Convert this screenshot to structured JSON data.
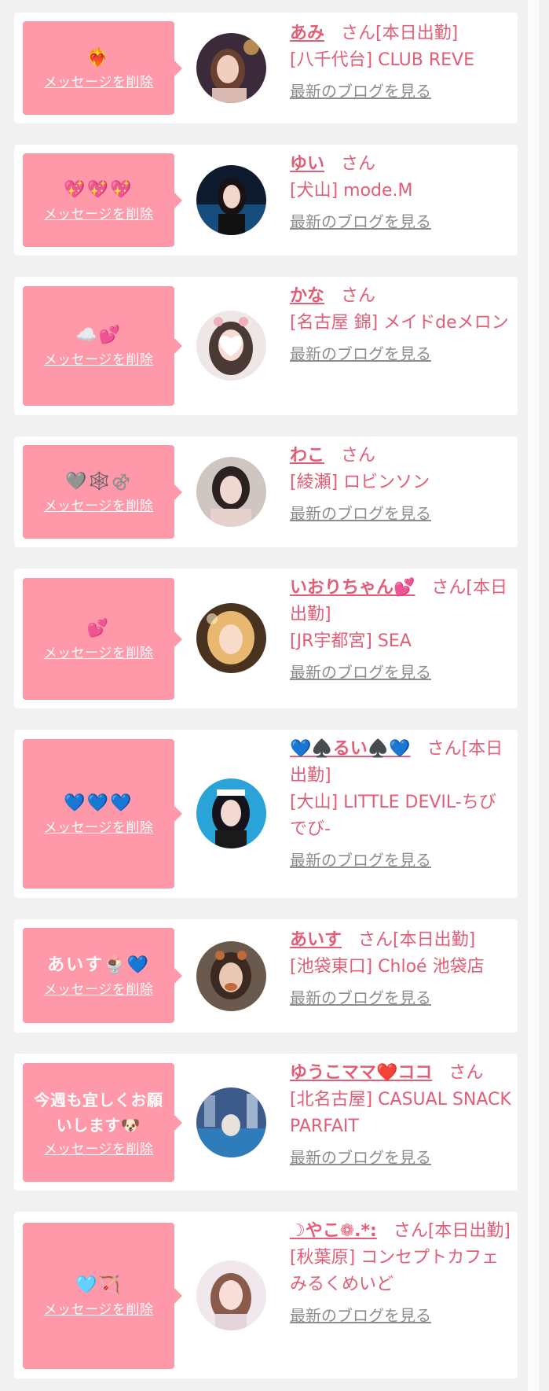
{
  "colors": {
    "bubble": "#ff98a8",
    "accent": "#e25d75",
    "blog_link": "#8d8d8d",
    "page_bg": "#f1f1f1",
    "card_bg": "#ffffff"
  },
  "delete_label": "メッセージを削除",
  "blog_label": "最新のブログを見る",
  "san_label": "さん",
  "on_duty_label": "[本日出勤]",
  "items": [
    {
      "message": "❤‍🔥",
      "name": "あみ",
      "on_duty": true,
      "shop": "[八千代台] CLUB REVE",
      "avatar_icon": "avatar-photo"
    },
    {
      "message": "💖💖💖",
      "name": "ゆい",
      "on_duty": false,
      "shop": "[犬山] mode.M",
      "avatar_icon": "avatar-photo"
    },
    {
      "message": "☁️💕",
      "name": "かな",
      "on_duty": false,
      "shop": "[名古屋 錦] メイドdeメロン",
      "avatar_icon": "avatar-photo"
    },
    {
      "message": "🩶🕸️⚣",
      "name": "わこ",
      "on_duty": false,
      "shop": "[綾瀬] ロビンソン",
      "avatar_icon": "avatar-photo"
    },
    {
      "message": "💕",
      "name": "いおりちゃん💕",
      "on_duty": true,
      "shop": "[JR宇都宮] SEA",
      "avatar_icon": "avatar-photo"
    },
    {
      "message": "💙💙💙",
      "name": "💙♠️るい♠️💙",
      "on_duty": true,
      "shop": "[大山] LITTLE DEVIL-ちびでび-",
      "avatar_icon": "avatar-photo"
    },
    {
      "message": "あいす🍨💙",
      "name": "あいす",
      "on_duty": true,
      "shop": "[池袋東口] Chloé 池袋店",
      "avatar_icon": "avatar-photo"
    },
    {
      "message": "今週も宜しくお願いします🐶",
      "name": "ゆうこママ❤️ココ",
      "on_duty": false,
      "shop": "[北名古屋] CASUAL SNACK PARFAIT",
      "avatar_icon": "avatar-photo"
    },
    {
      "message": "🩵🏹",
      "name": "☽やこ❁.*:",
      "on_duty": true,
      "shop": "[秋葉原] コンセプトカフェ みるくめいど",
      "avatar_icon": "avatar-photo"
    }
  ]
}
